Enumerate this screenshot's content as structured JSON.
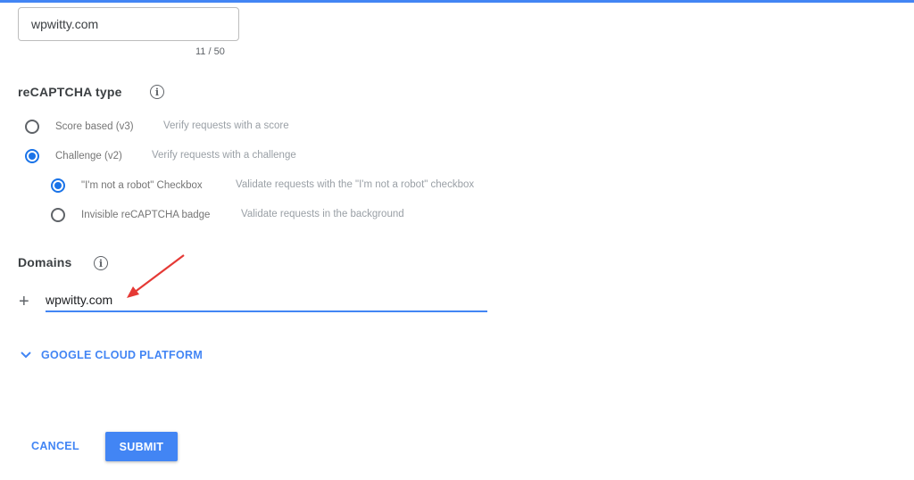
{
  "label_field": {
    "value": "wpwitty.com",
    "counter": "11 / 50"
  },
  "recaptcha_type": {
    "title": "reCAPTCHA type",
    "info_icon": "info-icon",
    "options": [
      {
        "label": "Score based (v3)",
        "description": "Verify requests with a score",
        "selected": false
      },
      {
        "label": "Challenge (v2)",
        "description": "Verify requests with a challenge",
        "selected": true
      }
    ],
    "sub_options": [
      {
        "label": "\"I'm not a robot\" Checkbox",
        "description": "Validate requests with the \"I'm not a robot\" checkbox",
        "selected": true
      },
      {
        "label": "Invisible reCAPTCHA badge",
        "description": "Validate requests in the background",
        "selected": false
      }
    ]
  },
  "domains": {
    "title": "Domains",
    "info_icon": "info-icon",
    "add_icon": "plus-icon",
    "value": "wpwitty.com",
    "annotation": "red-arrow"
  },
  "gcp_toggle": {
    "label": "GOOGLE CLOUD PLATFORM",
    "icon": "chevron-down-icon"
  },
  "actions": {
    "cancel": "CANCEL",
    "submit": "SUBMIT"
  },
  "colors": {
    "accent": "#4285f4",
    "radio_selected": "#1a73e8",
    "annotation": "#e53935"
  }
}
